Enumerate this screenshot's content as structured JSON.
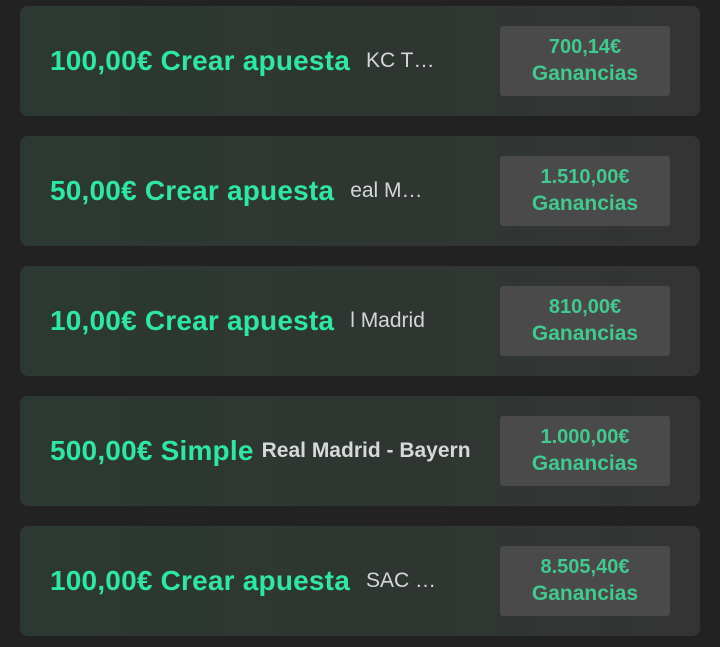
{
  "bets": [
    {
      "amount": "100,00€",
      "type": "Crear apuesta",
      "event": "KC Thunder",
      "payout": "700,14€",
      "payout_label": "Ganancias"
    },
    {
      "amount": "50,00€",
      "type": "Crear apuesta",
      "event": "eal Madrid",
      "payout": "1.510,00€",
      "payout_label": "Ganancias"
    },
    {
      "amount": "10,00€",
      "type": "Crear apuesta",
      "event": "l Madrid",
      "payout": "810,00€",
      "payout_label": "Ganancias"
    },
    {
      "amount": "500,00€",
      "type": "Simple",
      "event": "Real Madrid - Bayern",
      "payout": "1.000,00€",
      "payout_label": "Ganancias"
    },
    {
      "amount": "100,00€",
      "type": "Crear apuesta",
      "event": "SAC Kings",
      "payout": "8.505,40€",
      "payout_label": "Ganancias"
    }
  ],
  "colors": {
    "accent": "#2ee6a6",
    "payout_text": "#41c98f",
    "card_bg": "#2f3632",
    "payout_bg": "#4a4a4a",
    "page_bg": "#222222"
  }
}
